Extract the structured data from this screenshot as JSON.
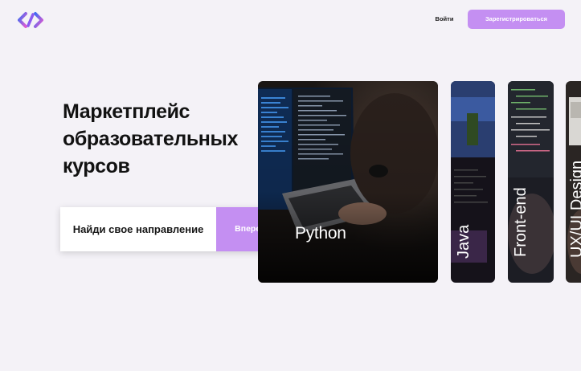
{
  "header": {
    "logo_icon": "code-brackets-logo",
    "login_label": "Войти",
    "register_label": "Зарегистрироваться"
  },
  "hero": {
    "title_lines": [
      "Маркетплейс",
      "образовательных",
      "курсов"
    ],
    "cta_label": "Найди свое направление",
    "cta_button": "Вперед"
  },
  "courses": [
    {
      "label": "Python"
    },
    {
      "label": "Java"
    },
    {
      "label": "Front-end"
    },
    {
      "label": "UX/UI Design"
    }
  ],
  "colors": {
    "accent": "#c48ff2",
    "background": "#f4f2f7",
    "logo_blue": "#4a5cf0",
    "logo_pink": "#e05ad1"
  }
}
